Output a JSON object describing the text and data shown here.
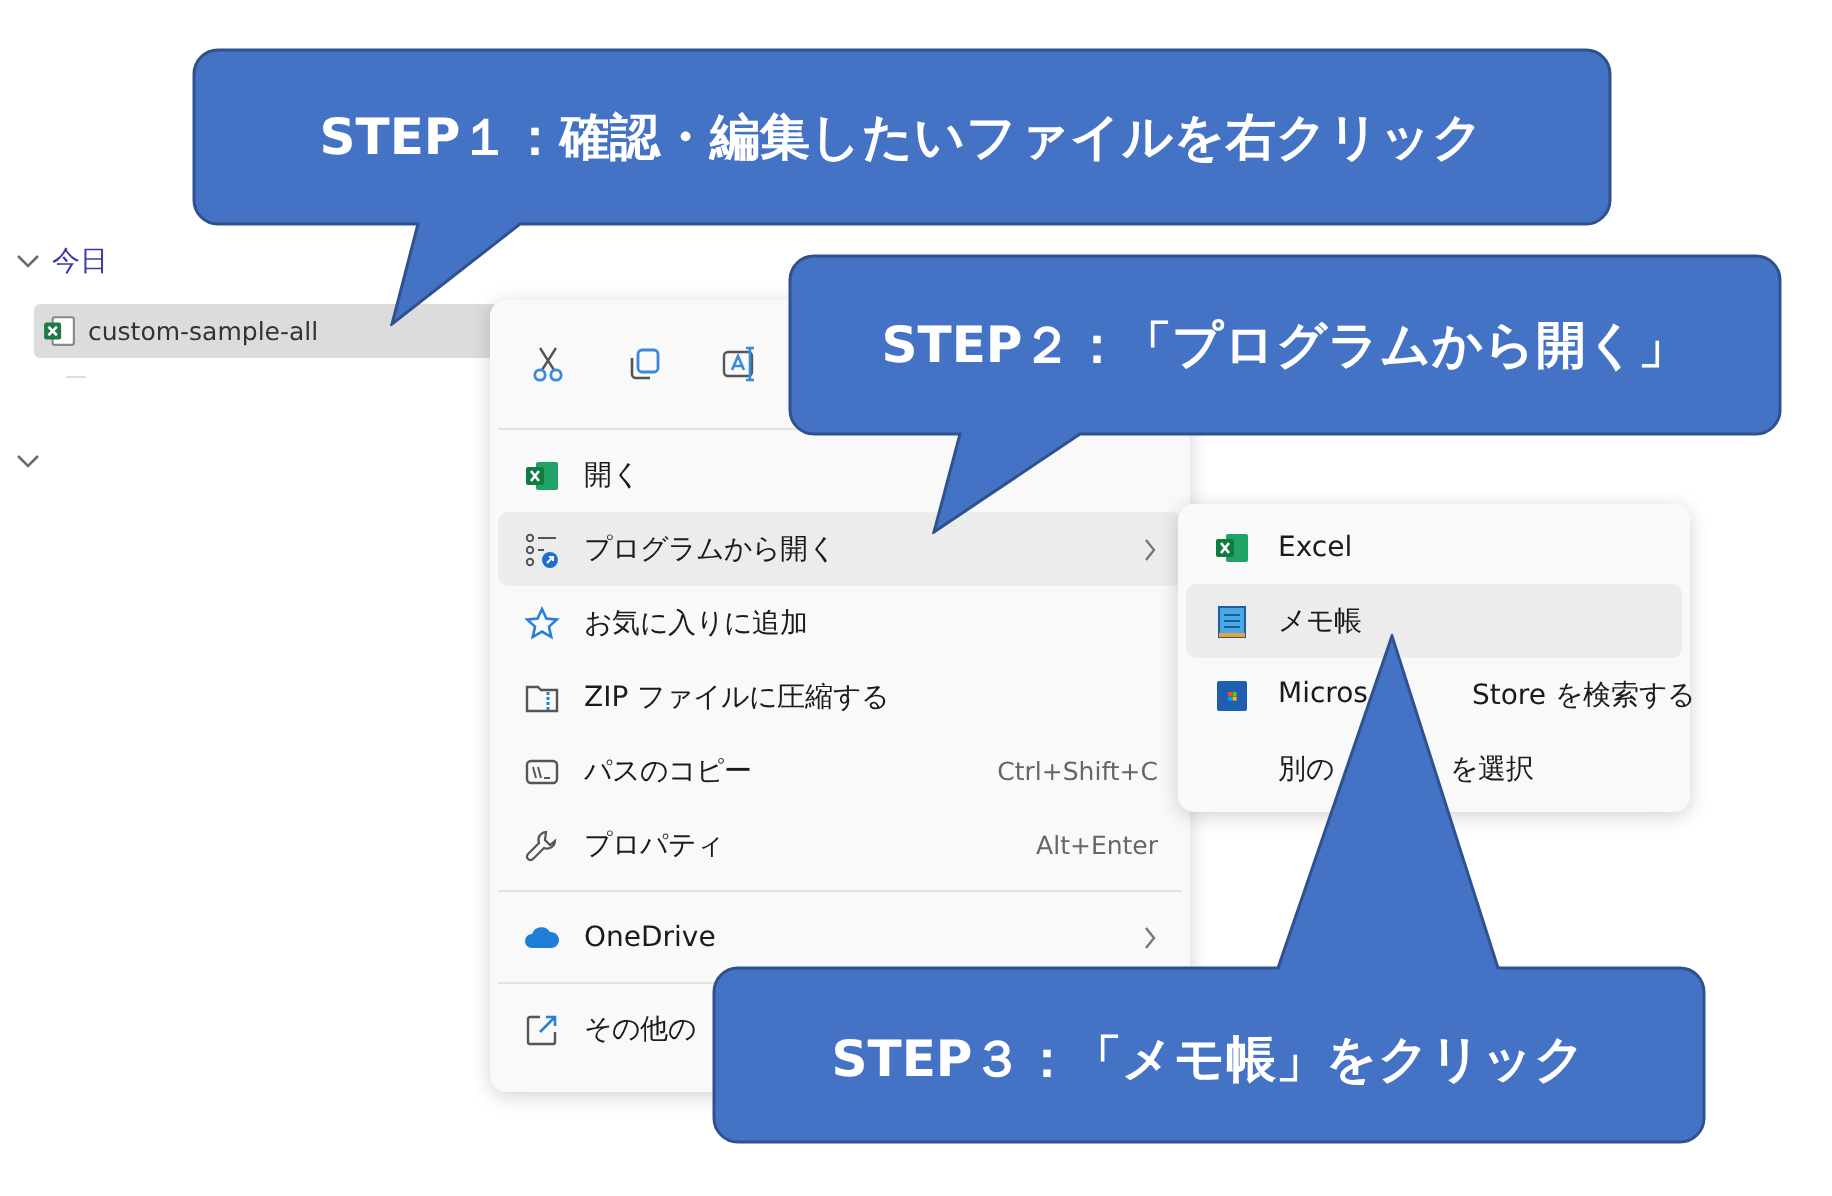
{
  "file_list": {
    "group_label": "今日",
    "files": [
      {
        "name": "custom-sample-all",
        "selected": true
      }
    ]
  },
  "context_menu": {
    "items": [
      {
        "kind": "item",
        "label": "開く",
        "selected": false
      },
      {
        "kind": "item",
        "label": "プログラムから開く",
        "submenu": true,
        "selected": true
      },
      {
        "kind": "item",
        "label": "お気に入りに追加",
        "selected": false
      },
      {
        "kind": "item",
        "label": "ZIP ファイルに圧縮する",
        "selected": false
      },
      {
        "kind": "item",
        "label": "パスのコピー",
        "shortcut": "Ctrl+Shift+C",
        "selected": false
      },
      {
        "kind": "item",
        "label": "プロパティ",
        "shortcut": "Alt+Enter",
        "selected": false
      },
      {
        "kind": "separator"
      },
      {
        "kind": "item",
        "label": "OneDrive",
        "submenu": true,
        "selected": false
      },
      {
        "kind": "separator"
      },
      {
        "kind": "item",
        "label": "その他の",
        "selected": false
      }
    ]
  },
  "submenu": {
    "items": [
      {
        "parts": [
          "Excel"
        ],
        "selected": false
      },
      {
        "parts": [
          "メモ帳"
        ],
        "selected": true
      },
      {
        "parts": [
          "Micros",
          "Store を検索する"
        ],
        "selected": false
      },
      {
        "parts": [
          "別の",
          "を選択"
        ],
        "selected": false
      }
    ]
  },
  "callouts": [
    "STEP１：確認・編集したいファイルを右クリック",
    "STEP２：「プログラムから開く」",
    "STEP３：「メモ帳」をクリック"
  ]
}
